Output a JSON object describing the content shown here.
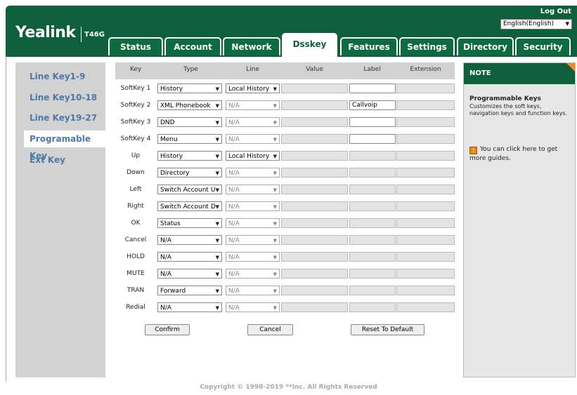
{
  "header": {
    "logo": "Yealink",
    "model": "T46G",
    "logout": "Log Out",
    "language": "English(English)"
  },
  "tabs": [
    {
      "label": "Status"
    },
    {
      "label": "Account"
    },
    {
      "label": "Network"
    },
    {
      "label": "Dsskey",
      "active": true
    },
    {
      "label": "Features"
    },
    {
      "label": "Settings"
    },
    {
      "label": "Directory"
    },
    {
      "label": "Security"
    }
  ],
  "sidebar": {
    "items": [
      {
        "label": "Line Key1-9"
      },
      {
        "label": "Line Key10-18"
      },
      {
        "label": "Line Key19-27"
      },
      {
        "label": "Programable Key",
        "active": true
      },
      {
        "label": "Ext Key"
      }
    ]
  },
  "table": {
    "headers": {
      "key": "Key",
      "type": "Type",
      "line": "Line",
      "value": "Value",
      "label": "Label",
      "extension": "Extension"
    },
    "rows": [
      {
        "key": "SoftKey 1",
        "type": "History",
        "line": "Local History",
        "line_enabled": true,
        "label": "",
        "label_enabled": true
      },
      {
        "key": "SoftKey 2",
        "type": "XML Phonebook",
        "line": "N/A",
        "line_enabled": false,
        "label": "Callvoip",
        "label_enabled": true
      },
      {
        "key": "SoftKey 3",
        "type": "DND",
        "line": "N/A",
        "line_enabled": false,
        "label": "",
        "label_enabled": true
      },
      {
        "key": "SoftKey 4",
        "type": "Menu",
        "line": "N/A",
        "line_enabled": false,
        "label": "",
        "label_enabled": true
      },
      {
        "key": "Up",
        "type": "History",
        "line": "Local History",
        "line_enabled": true,
        "label": "",
        "label_enabled": false
      },
      {
        "key": "Down",
        "type": "Directory",
        "line": "N/A",
        "line_enabled": false,
        "label": "",
        "label_enabled": false
      },
      {
        "key": "Left",
        "type": "Switch Account U",
        "line": "N/A",
        "line_enabled": false,
        "label": "",
        "label_enabled": false
      },
      {
        "key": "Right",
        "type": "Switch Account D",
        "line": "N/A",
        "line_enabled": false,
        "label": "",
        "label_enabled": false
      },
      {
        "key": "OK",
        "type": "Status",
        "line": "N/A",
        "line_enabled": false,
        "label": "",
        "label_enabled": false
      },
      {
        "key": "Cancel",
        "type": "N/A",
        "line": "N/A",
        "line_enabled": false,
        "label": "",
        "label_enabled": false
      },
      {
        "key": "HOLD",
        "type": "N/A",
        "line": "N/A",
        "line_enabled": false,
        "label": "",
        "label_enabled": false
      },
      {
        "key": "MUTE",
        "type": "N/A",
        "line": "N/A",
        "line_enabled": false,
        "label": "",
        "label_enabled": false
      },
      {
        "key": "TRAN",
        "type": "Forward",
        "line": "N/A",
        "line_enabled": false,
        "label": "",
        "label_enabled": false
      },
      {
        "key": "Redial",
        "type": "N/A",
        "line": "N/A",
        "line_enabled": false,
        "label": "",
        "label_enabled": false
      }
    ]
  },
  "buttons": {
    "confirm": "Confirm",
    "cancel": "Cancel",
    "reset": "Reset To Default"
  },
  "note": {
    "title": "NOTE",
    "heading": "Programmable Keys",
    "text": "Customizes the soft keys, navigation keys and function keys.",
    "guide_icon": "!",
    "guide": "You can click here to get more guides."
  },
  "footer": {
    "copyright": "Copyright © 1998-2019 **Inc. All Rights Reserved"
  },
  "colors": {
    "brand_green": "#0e5f3c",
    "sidebar_link": "#4e79a7",
    "panel_gray": "#d2d2d2",
    "note_accent": "#f28c28"
  }
}
